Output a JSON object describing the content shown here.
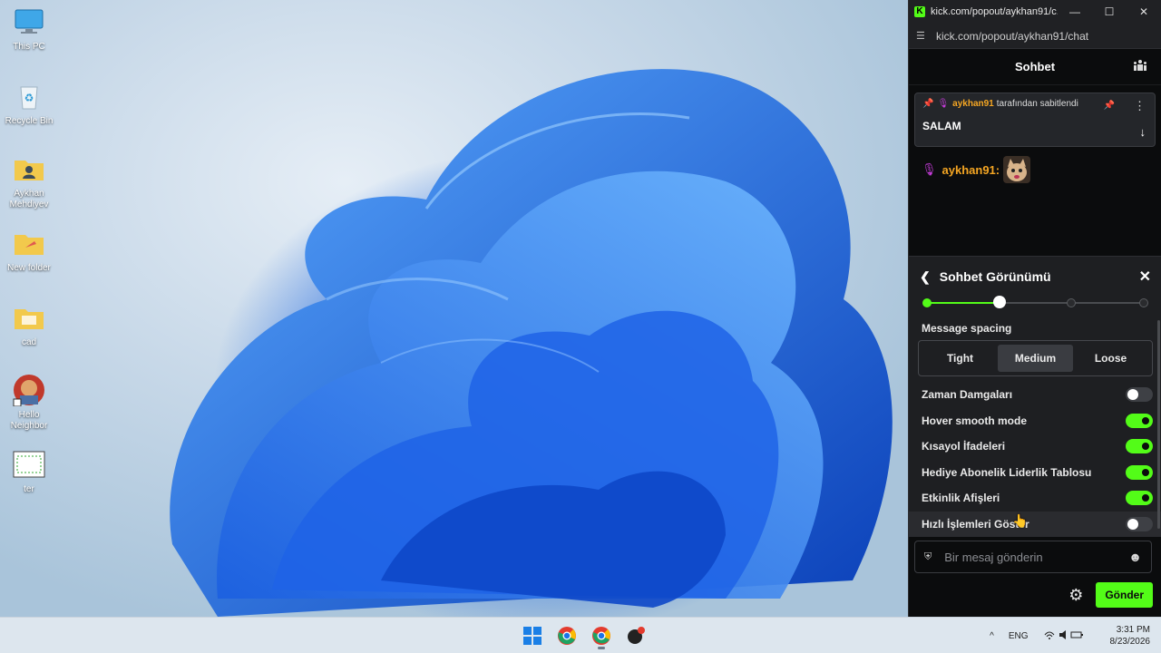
{
  "desktop": {
    "icons": [
      {
        "label": "This PC",
        "icon": "monitor-icon"
      },
      {
        "label": "Recycle Bin",
        "icon": "recycle-bin-icon"
      },
      {
        "label": "Aykhan Mehdiyev",
        "icon": "user-folder-icon"
      },
      {
        "label": "New folder",
        "icon": "folder-icon"
      },
      {
        "label": "cad",
        "icon": "folder-icon"
      },
      {
        "label": "Hello Neighbor",
        "icon": "game-shortcut-icon"
      },
      {
        "label": "ter",
        "icon": "image-file-icon"
      }
    ]
  },
  "window": {
    "title": "kick.com/popout/aykhan91/c...",
    "url": "kick.com/popout/aykhan91/chat",
    "minimize": "—",
    "maximize": "☐",
    "close": "✕"
  },
  "chat": {
    "header_title": "Sohbet",
    "pinned": {
      "author": "aykhan91",
      "pinned_by_text": "tarafından sabitlendi",
      "message": "SALAM"
    },
    "message": {
      "author": "aykhan91",
      "separator": ":"
    }
  },
  "appearance_panel": {
    "title": "Sohbet Görünümü",
    "font_size_level": 2,
    "font_size_levels": 4,
    "spacing_label": "Message spacing",
    "spacing_options": [
      "Tight",
      "Medium",
      "Loose"
    ],
    "spacing_selected": "Medium",
    "toggles": [
      {
        "label": "Zaman Damgaları",
        "on": false
      },
      {
        "label": "Hover smooth mode",
        "on": true
      },
      {
        "label": "Kısayol İfadeleri",
        "on": true
      },
      {
        "label": "Hediye Abonelik Liderlik Tablosu",
        "on": true
      },
      {
        "label": "Etkinlik Afişleri",
        "on": true
      },
      {
        "label": "Hızlı İşlemleri Göster",
        "on": false
      }
    ]
  },
  "composer": {
    "placeholder": "Bir mesaj gönderin",
    "send_label": "Gönder"
  },
  "taskbar": {
    "language": "ENG",
    "time": "3:31 PM",
    "date": "8/23/2026",
    "tray_arrow": "^"
  },
  "colors": {
    "accent": "#53fc18",
    "username": "#f5a623",
    "badge": "#c23bd6"
  }
}
